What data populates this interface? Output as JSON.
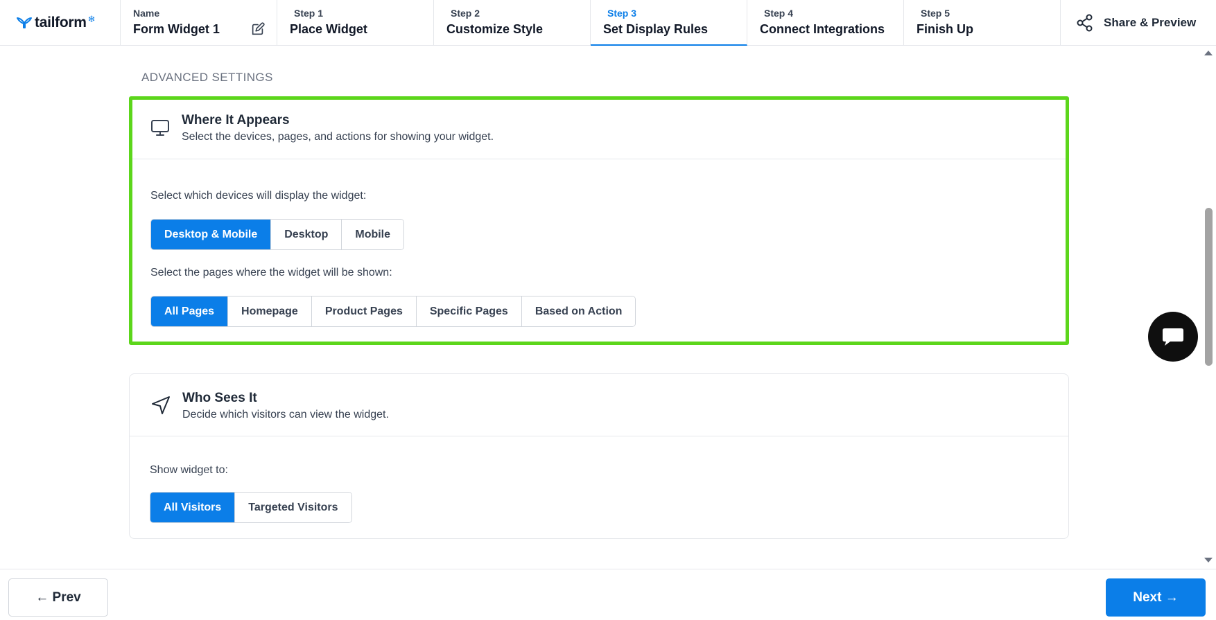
{
  "brand": {
    "name": "tailform",
    "accent": "#0b7ee8",
    "highlight": "#5cd61b"
  },
  "header": {
    "name_label": "Name",
    "name_value": "Form Widget 1",
    "steps": [
      {
        "num": "Step 1",
        "label": "Place Widget"
      },
      {
        "num": "Step 2",
        "label": "Customize Style"
      },
      {
        "num": "Step 3",
        "label": "Set Display Rules"
      },
      {
        "num": "Step 4",
        "label": "Connect Integrations"
      },
      {
        "num": "Step 5",
        "label": "Finish Up"
      }
    ],
    "active_step": "Step 3",
    "share_label": "Share & Preview"
  },
  "main": {
    "section_heading": "ADVANCED SETTINGS",
    "where": {
      "title": "Where It Appears",
      "description": "Select the devices, pages, and actions for showing your widget.",
      "devices_label": "Select which devices will display the widget:",
      "devices": [
        "Desktop & Mobile",
        "Desktop",
        "Mobile"
      ],
      "devices_selected": "Desktop & Mobile",
      "pages_label": "Select the pages where the widget will be shown:",
      "pages": [
        "All Pages",
        "Homepage",
        "Product Pages",
        "Specific Pages",
        "Based on Action"
      ],
      "pages_selected": "All Pages"
    },
    "who": {
      "title": "Who Sees It",
      "description": "Decide which visitors can view the widget.",
      "show_label": "Show widget to:",
      "options": [
        "All Visitors",
        "Targeted Visitors"
      ],
      "selected": "All Visitors"
    }
  },
  "footer": {
    "prev_label": "← Prev",
    "next_label": "Next →"
  },
  "icons": {
    "logo": "tail-icon",
    "edit": "edit-icon",
    "share": "share-icon",
    "monitor": "monitor-icon",
    "navigation": "navigation-arrow-icon",
    "chat": "chat-icon"
  }
}
